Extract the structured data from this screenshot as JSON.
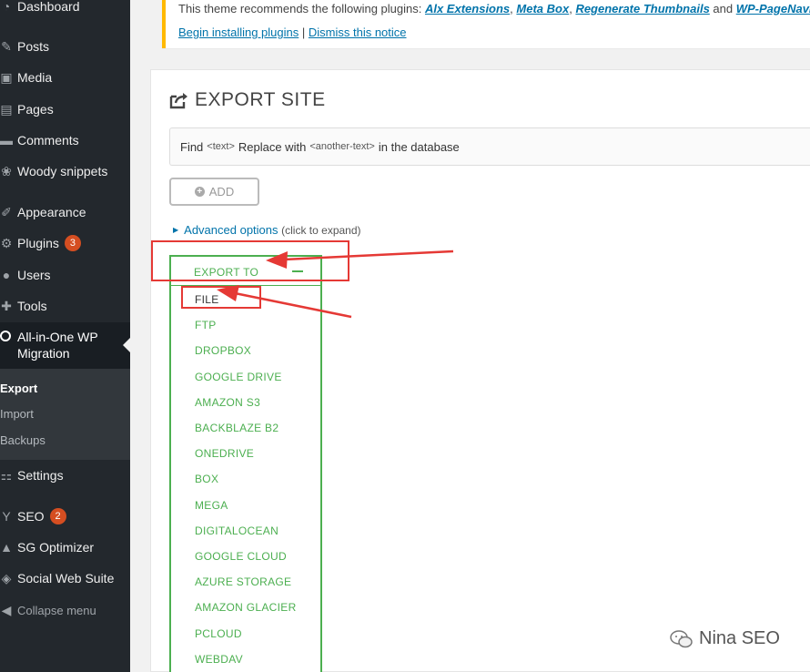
{
  "sidebar": {
    "items": [
      {
        "label": "Dashboard",
        "icon": "dashboard-icon"
      },
      {
        "label": "Posts",
        "icon": "pin-icon"
      },
      {
        "label": "Media",
        "icon": "media-icon"
      },
      {
        "label": "Pages",
        "icon": "pages-icon"
      },
      {
        "label": "Comments",
        "icon": "comments-icon"
      },
      {
        "label": "Woody snippets",
        "icon": "snippets-icon"
      },
      {
        "label": "Appearance",
        "icon": "brush-icon"
      },
      {
        "label": "Plugins",
        "icon": "plugin-icon",
        "badge": "3"
      },
      {
        "label": "Users",
        "icon": "users-icon"
      },
      {
        "label": "Tools",
        "icon": "tools-icon"
      },
      {
        "label": "All-in-One WP Migration",
        "icon": "migration-icon"
      },
      {
        "label": "Settings",
        "icon": "settings-icon"
      },
      {
        "label": "SEO",
        "icon": "seo-icon",
        "badge": "2"
      },
      {
        "label": "SG Optimizer",
        "icon": "optimizer-icon"
      },
      {
        "label": "Social Web Suite",
        "icon": "social-icon"
      },
      {
        "label": "Collapse menu",
        "icon": "collapse-icon"
      }
    ],
    "submenu": [
      "Export",
      "Import",
      "Backups"
    ]
  },
  "notice": {
    "prefix": "This theme recommends the following plugins: ",
    "plugins": [
      "Alx Extensions",
      "Meta Box",
      "Regenerate Thumbnails",
      "WP-PageNavi"
    ],
    "sep1": ", ",
    "sep2": ", ",
    "and": " and ",
    "begin": "Begin installing plugins",
    "divider": " | ",
    "dismiss": "Dismiss this notice"
  },
  "main": {
    "title": "EXPORT SITE",
    "find": {
      "find": "Find",
      "code1": "<text>",
      "replace": "Replace with",
      "code2": "<another-text>",
      "suffix": "in the database"
    },
    "add_label": "ADD",
    "advanced": {
      "label": "Advanced options",
      "hint": "(click to expand)"
    },
    "export_to": "EXPORT TO",
    "options": [
      "FILE",
      "FTP",
      "DROPBOX",
      "GOOGLE DRIVE",
      "AMAZON S3",
      "BACKBLAZE B2",
      "ONEDRIVE",
      "BOX",
      "MEGA",
      "DIGITALOCEAN",
      "GOOGLE CLOUD",
      "AZURE STORAGE",
      "AMAZON GLACIER",
      "PCLOUD",
      "WEBDAV"
    ]
  },
  "watermark": "Nina SEO",
  "colors": {
    "sidebar": "#23282d",
    "accent": "#0073aa",
    "green": "#4caf50",
    "annotation": "#e53935",
    "badge": "#d54e21"
  }
}
